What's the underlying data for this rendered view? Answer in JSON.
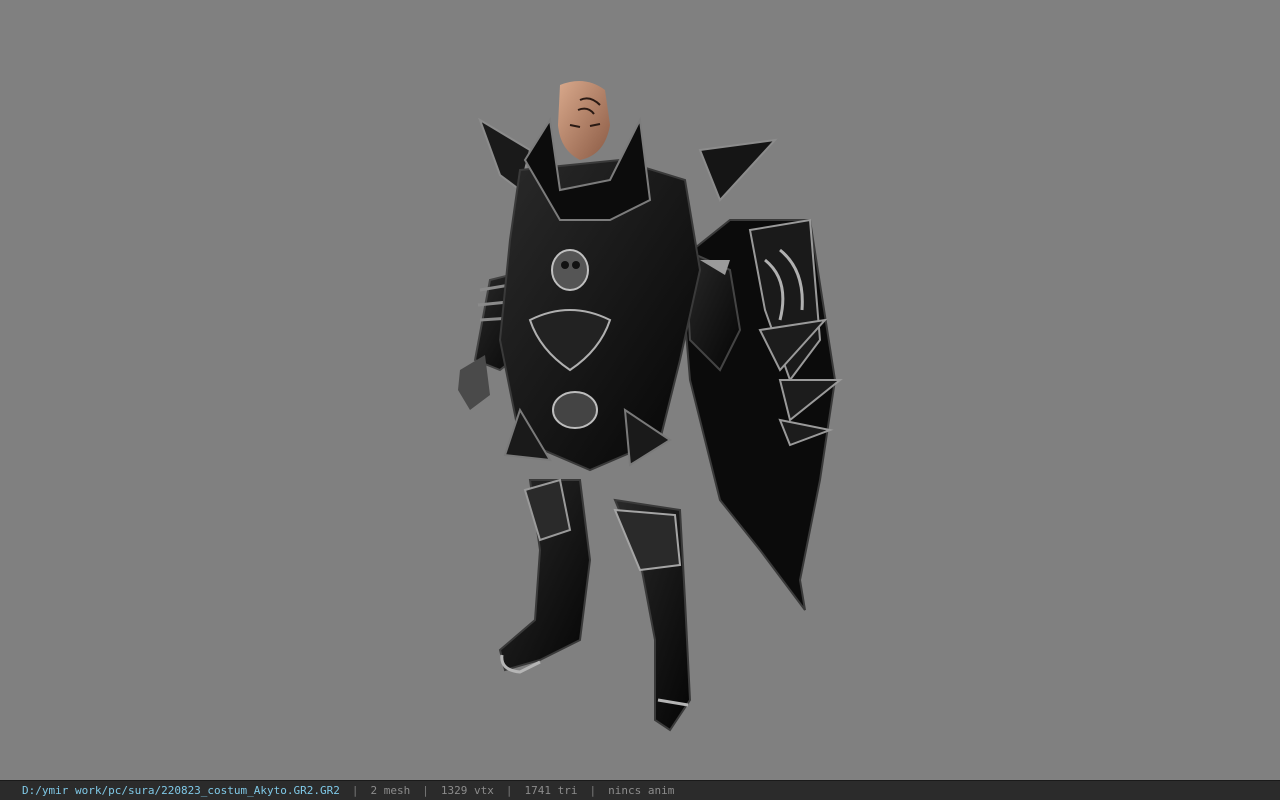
{
  "viewer": {
    "background_color": "#808080",
    "model_name": "sura costume Akyto"
  },
  "status_bar": {
    "file_path": "D:/ymir work/pc/sura/220823_costum_Akyto.GR2.GR2",
    "separator": "|",
    "mesh_count": "2 mesh",
    "vertex_count": "1329 vtx",
    "triangle_count": "1741 tri",
    "anim_status": "nincs anim",
    "path_color": "#7fc8e6",
    "text_color": "#8c8c8c"
  }
}
